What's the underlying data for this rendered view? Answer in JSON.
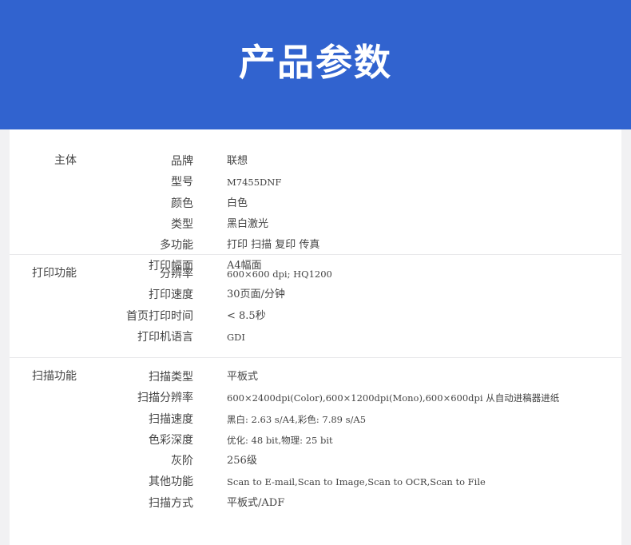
{
  "banner": {
    "title": "产品参数"
  },
  "sections": [
    {
      "title": "主体",
      "rows": [
        {
          "key": "品牌",
          "value": "联想"
        },
        {
          "key": "型号",
          "value": "M7455DNF"
        },
        {
          "key": "颜色",
          "value": "白色"
        },
        {
          "key": "类型",
          "value": "黑白激光"
        },
        {
          "key": "多功能",
          "value": "打印 扫描 复印 传真"
        },
        {
          "key": "打印幅面",
          "value": "A4幅面"
        }
      ]
    },
    {
      "title": "打印功能",
      "rows": [
        {
          "key": "分辨率",
          "value": "600×600 dpi; HQ1200"
        },
        {
          "key": "打印速度",
          "value": "30页面/分钟"
        },
        {
          "key": "首页打印时间",
          "value": "< 8.5秒"
        },
        {
          "key": "打印机语言",
          "value": "GDI"
        }
      ]
    },
    {
      "title": "扫描功能",
      "rows": [
        {
          "key": "扫描类型",
          "value": "平板式"
        },
        {
          "key": "扫描分辨率",
          "value": "600×2400dpi(Color),600×1200dpi(Mono),600×600dpi 从自动进稿器进纸"
        },
        {
          "key": "扫描速度",
          "value": "黑白: 2.63 s/A4,彩色: 7.89 s/A5"
        },
        {
          "key": "色彩深度",
          "value": "优化: 48 bit,物理: 25 bit"
        },
        {
          "key": "灰阶",
          "value": "256级"
        },
        {
          "key": "其他功能",
          "value": "Scan to E-mail,Scan to Image,Scan to OCR,Scan to File"
        },
        {
          "key": "扫描方式",
          "value": "平板式/ADF"
        }
      ]
    }
  ]
}
